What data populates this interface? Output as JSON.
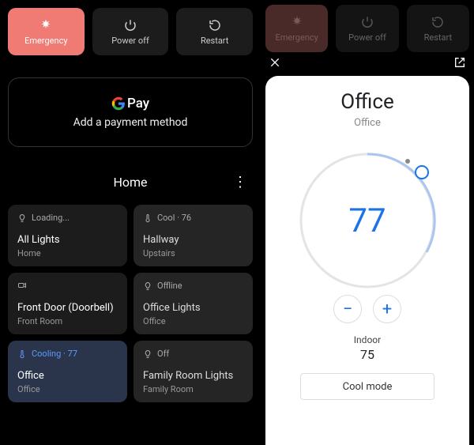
{
  "power": {
    "emergency": "Emergency",
    "poweroff": "Power off",
    "restart": "Restart"
  },
  "pay": {
    "brand": "Pay",
    "subtitle": "Add a payment method"
  },
  "home": {
    "title": "Home"
  },
  "tiles": [
    {
      "status": "Loading...",
      "name": "All Lights",
      "room": "Home"
    },
    {
      "status": "Cool · 76",
      "name": "Hallway",
      "room": "Upstairs"
    },
    {
      "status": "",
      "name": "Front Door (Doorbell)",
      "room": "Front Room"
    },
    {
      "status": "Offline",
      "name": "Office Lights",
      "room": "Office"
    },
    {
      "status": "Cooling · 77",
      "name": "Office",
      "room": "Office"
    },
    {
      "status": "Off",
      "name": "Family Room Lights",
      "room": "Family Room"
    }
  ],
  "thermo": {
    "title": "Office",
    "subtitle": "Office",
    "setpoint": "77",
    "indoor_label": "Indoor",
    "indoor_value": "75",
    "mode": "Cool mode"
  },
  "icons": {
    "bulb": "bulb-icon",
    "therm": "thermometer-icon",
    "cam": "camera-icon",
    "power": "power-icon",
    "restart": "restart-icon",
    "asterisk": "emergency-icon"
  }
}
